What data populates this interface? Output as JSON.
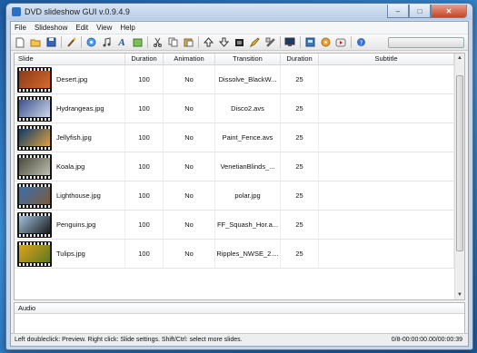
{
  "window": {
    "title": "DVD slideshow GUI v.0.9.4.9"
  },
  "window_buttons": {
    "minimize": "–",
    "maximize": "□",
    "close": "✕"
  },
  "menu": [
    "File",
    "Slideshow",
    "Edit",
    "View",
    "Help"
  ],
  "toolbar_icons": [
    "new-icon",
    "open-icon",
    "save-icon",
    "effects-icon",
    "add-images-icon",
    "add-music-icon",
    "add-text-icon",
    "add-fade-icon",
    "cut-icon",
    "copy-icon",
    "paste-icon",
    "move-up-icon",
    "move-down-icon",
    "film-icon",
    "rename-icon",
    "settings-icon",
    "preview-icon",
    "export-icon",
    "burn-icon",
    "youtube-icon",
    "help-icon"
  ],
  "table": {
    "columns": [
      "Slide",
      "Duration",
      "Animation",
      "Transition",
      "Duration",
      "Subtitle"
    ],
    "rows": [
      {
        "name": "Desert.jpg",
        "duration": "100",
        "animation": "No",
        "transition": "Dissolve_BlackW...",
        "trans_duration": "25",
        "subtitle": "",
        "thumb": [
          "#8a3b1a",
          "#d46a2b"
        ]
      },
      {
        "name": "Hydrangeas.jpg",
        "duration": "100",
        "animation": "No",
        "transition": "Disco2.avs",
        "trans_duration": "25",
        "subtitle": "",
        "thumb": [
          "#3a4f8f",
          "#cfd9e8"
        ]
      },
      {
        "name": "Jellyfish.jpg",
        "duration": "100",
        "animation": "No",
        "transition": "Paint_Fence.avs",
        "trans_duration": "25",
        "subtitle": "",
        "thumb": [
          "#0b3a6a",
          "#e0a040"
        ]
      },
      {
        "name": "Koala.jpg",
        "duration": "100",
        "animation": "No",
        "transition": "VenetianBlinds_...",
        "trans_duration": "25",
        "subtitle": "",
        "thumb": [
          "#4a4a3a",
          "#bfbfb2"
        ]
      },
      {
        "name": "Lighthouse.jpg",
        "duration": "100",
        "animation": "No",
        "transition": "polar.jpg",
        "trans_duration": "25",
        "subtitle": "",
        "thumb": [
          "#3b6fb0",
          "#7d5a3a"
        ]
      },
      {
        "name": "Penguins.jpg",
        "duration": "100",
        "animation": "No",
        "transition": "FF_Squash_Hor.a...",
        "trans_duration": "25",
        "subtitle": "",
        "thumb": [
          "#9fc2e0",
          "#1a1a1a"
        ]
      },
      {
        "name": "Tulips.jpg",
        "duration": "100",
        "animation": "No",
        "transition": "Ripples_NWSE_2....",
        "trans_duration": "25",
        "subtitle": "",
        "thumb": [
          "#e0a21a",
          "#5a7a20"
        ]
      }
    ]
  },
  "audio": {
    "label": "Audio"
  },
  "status": {
    "hint": "Left doubleclick: Preview. Right click: Slide settings. Shift/Ctrl: select more slides.",
    "time": "0/8-00:00:00.00/00:00:39"
  }
}
